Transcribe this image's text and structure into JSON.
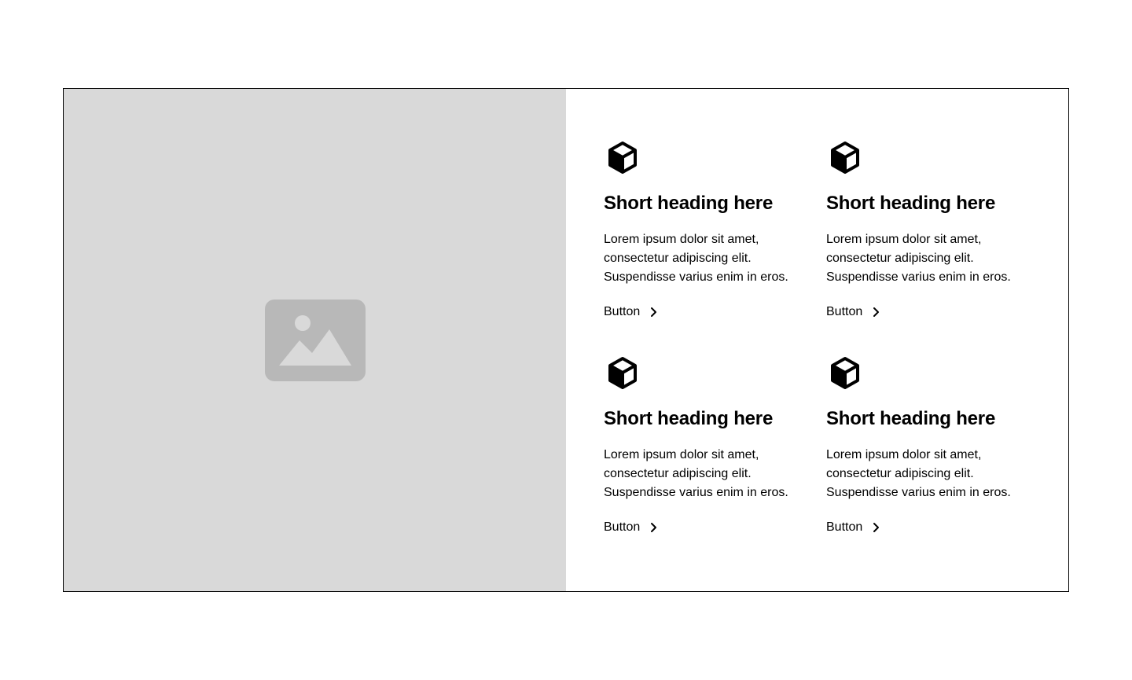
{
  "colors": {
    "background": "#ffffff",
    "media_placeholder": "#d9d9d9",
    "placeholder_icon": "#b8b8b8",
    "border": "#000000",
    "text": "#000000"
  },
  "media": {
    "icon": "image-placeholder-icon"
  },
  "features": [
    {
      "icon": "cube-icon",
      "heading": "Short heading here",
      "text": "Lorem ipsum dolor sit amet, consectetur adipiscing elit. Suspendisse varius enim in eros.",
      "button_label": "Button",
      "button_icon": "chevron-right-icon"
    },
    {
      "icon": "cube-icon",
      "heading": "Short heading here",
      "text": "Lorem ipsum dolor sit amet, consectetur adipiscing elit. Suspendisse varius enim in eros.",
      "button_label": "Button",
      "button_icon": "chevron-right-icon"
    },
    {
      "icon": "cube-icon",
      "heading": "Short heading here",
      "text": "Lorem ipsum dolor sit amet, consectetur adipiscing elit. Suspendisse varius enim in eros.",
      "button_label": "Button",
      "button_icon": "chevron-right-icon"
    },
    {
      "icon": "cube-icon",
      "heading": "Short heading here",
      "text": "Lorem ipsum dolor sit amet, consectetur adipiscing elit. Suspendisse varius enim in eros.",
      "button_label": "Button",
      "button_icon": "chevron-right-icon"
    }
  ]
}
